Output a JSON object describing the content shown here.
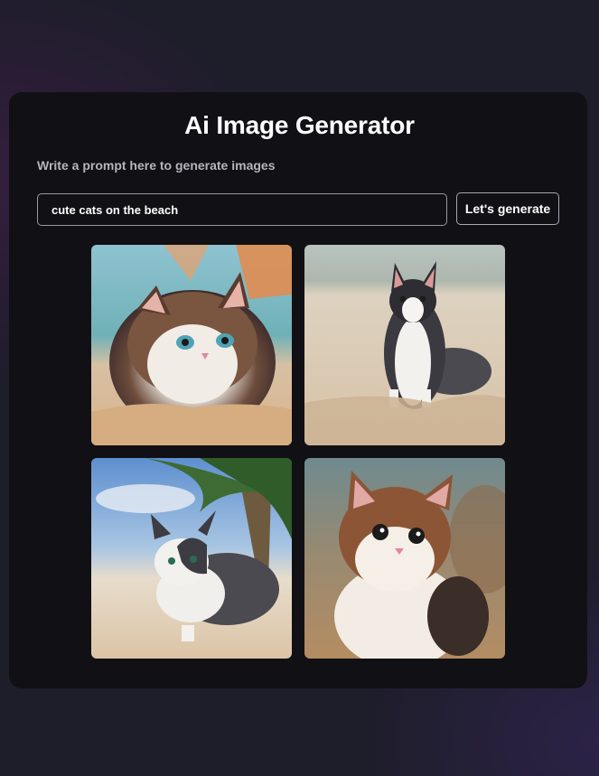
{
  "app": {
    "title": "Ai Image Generator",
    "subtitle": "Write a prompt here to generate images"
  },
  "prompt": {
    "value": "cute cats on the beach"
  },
  "generate_button": {
    "label": "Let's generate"
  },
  "results": {
    "images": [
      {
        "icon": "cat-on-beach-image",
        "subject": "fluffy brown and white cat with blue eyes"
      },
      {
        "icon": "cat-on-beach-image",
        "subject": "black and white cat sitting on sand"
      },
      {
        "icon": "cat-on-beach-image",
        "subject": "black and white cat walking under palm tree"
      },
      {
        "icon": "cat-on-beach-image",
        "subject": "brown tabby and white kitten"
      }
    ]
  },
  "colors": {
    "page_background": "#1e1d2a",
    "card_background": "#111015",
    "text_primary": "#ffffff",
    "text_secondary": "#b7b4bd",
    "border": "#9a98a3"
  }
}
